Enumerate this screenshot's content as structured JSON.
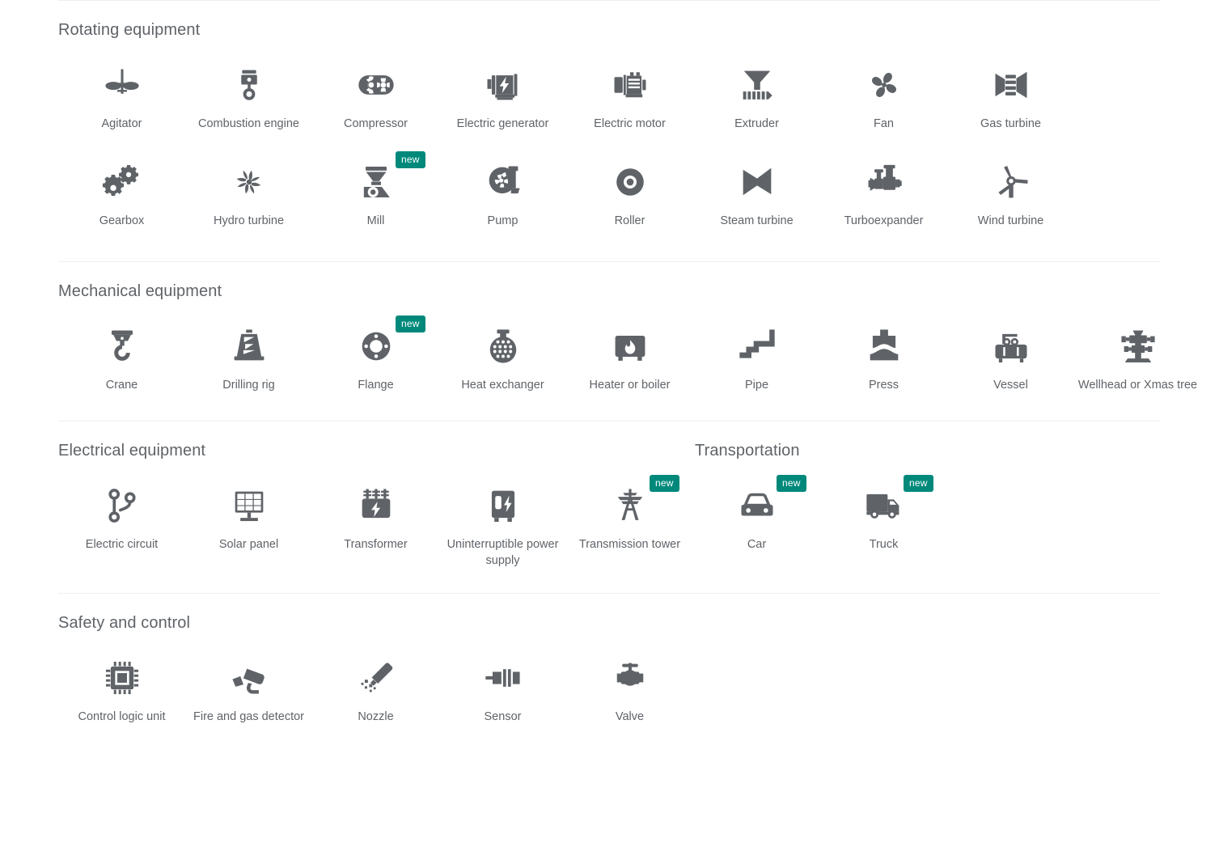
{
  "badge_label": "new",
  "colors": {
    "icon": "#5f6368",
    "label": "#5f6368",
    "heading": "#5f6368",
    "badge_background": "#00897b",
    "badge_text": "#ffffff",
    "divider": "#eceff1",
    "page_background": "#ffffff"
  },
  "sections": [
    {
      "title": "Rotating equipment",
      "rows": [
        [
          {
            "label": "Agitator",
            "icon": "agitator-icon",
            "new": false
          },
          {
            "label": "Combustion engine",
            "icon": "combustion-engine-icon",
            "new": false
          },
          {
            "label": "Compressor",
            "icon": "compressor-icon",
            "new": false
          },
          {
            "label": "Electric generator",
            "icon": "electric-generator-icon",
            "new": false
          },
          {
            "label": "Electric motor",
            "icon": "electric-motor-icon",
            "new": false
          },
          {
            "label": "Extruder",
            "icon": "extruder-icon",
            "new": false
          },
          {
            "label": "Fan",
            "icon": "fan-icon",
            "new": false
          },
          {
            "label": "Gas turbine",
            "icon": "gas-turbine-icon",
            "new": false
          }
        ],
        [
          {
            "label": "Gearbox",
            "icon": "gearbox-icon",
            "new": false
          },
          {
            "label": "Hydro turbine",
            "icon": "hydro-turbine-icon",
            "new": false
          },
          {
            "label": "Mill",
            "icon": "mill-icon",
            "new": true
          },
          {
            "label": "Pump",
            "icon": "pump-icon",
            "new": false
          },
          {
            "label": "Roller",
            "icon": "roller-icon",
            "new": false
          },
          {
            "label": "Steam turbine",
            "icon": "steam-turbine-icon",
            "new": false
          },
          {
            "label": "Turboexpander",
            "icon": "turboexpander-icon",
            "new": false
          },
          {
            "label": "Wind turbine",
            "icon": "wind-turbine-icon",
            "new": false
          }
        ]
      ]
    },
    {
      "title": "Mechanical equipment",
      "rows": [
        [
          {
            "label": "Crane",
            "icon": "crane-icon",
            "new": false
          },
          {
            "label": "Drilling rig",
            "icon": "drilling-rig-icon",
            "new": false
          },
          {
            "label": "Flange",
            "icon": "flange-icon",
            "new": true
          },
          {
            "label": "Heat exchanger",
            "icon": "heat-exchanger-icon",
            "new": false
          },
          {
            "label": "Heater or boiler",
            "icon": "heater-or-boiler-icon",
            "new": false
          },
          {
            "label": "Pipe",
            "icon": "pipe-icon",
            "new": false
          },
          {
            "label": "Press",
            "icon": "press-icon",
            "new": false
          },
          {
            "label": "Vessel",
            "icon": "vessel-icon",
            "new": false
          },
          {
            "label": "Wellhead or Xmas tree",
            "icon": "wellhead-icon",
            "new": false
          }
        ]
      ]
    },
    {
      "title": "Electrical equipment",
      "title2": "Transportation",
      "rows": [
        [
          {
            "label": "Electric circuit",
            "icon": "electric-circuit-icon",
            "new": false
          },
          {
            "label": "Solar panel",
            "icon": "solar-panel-icon",
            "new": false
          },
          {
            "label": "Transformer",
            "icon": "transformer-icon",
            "new": false
          },
          {
            "label": "Uninterruptible power supply",
            "icon": "ups-icon",
            "new": false
          },
          {
            "label": "Transmission tower",
            "icon": "transmission-tower-icon",
            "new": true
          },
          {
            "label": "Car",
            "icon": "car-icon",
            "new": true
          },
          {
            "label": "Truck",
            "icon": "truck-icon",
            "new": true
          }
        ]
      ]
    },
    {
      "title": "Safety and control",
      "rows": [
        [
          {
            "label": "Control logic unit",
            "icon": "control-logic-unit-icon",
            "new": false
          },
          {
            "label": "Fire and gas detector",
            "icon": "fire-and-gas-detector-icon",
            "new": false
          },
          {
            "label": "Nozzle",
            "icon": "nozzle-icon",
            "new": false
          },
          {
            "label": "Sensor",
            "icon": "sensor-icon",
            "new": false
          },
          {
            "label": "Valve",
            "icon": "valve-icon",
            "new": false
          }
        ]
      ]
    }
  ]
}
